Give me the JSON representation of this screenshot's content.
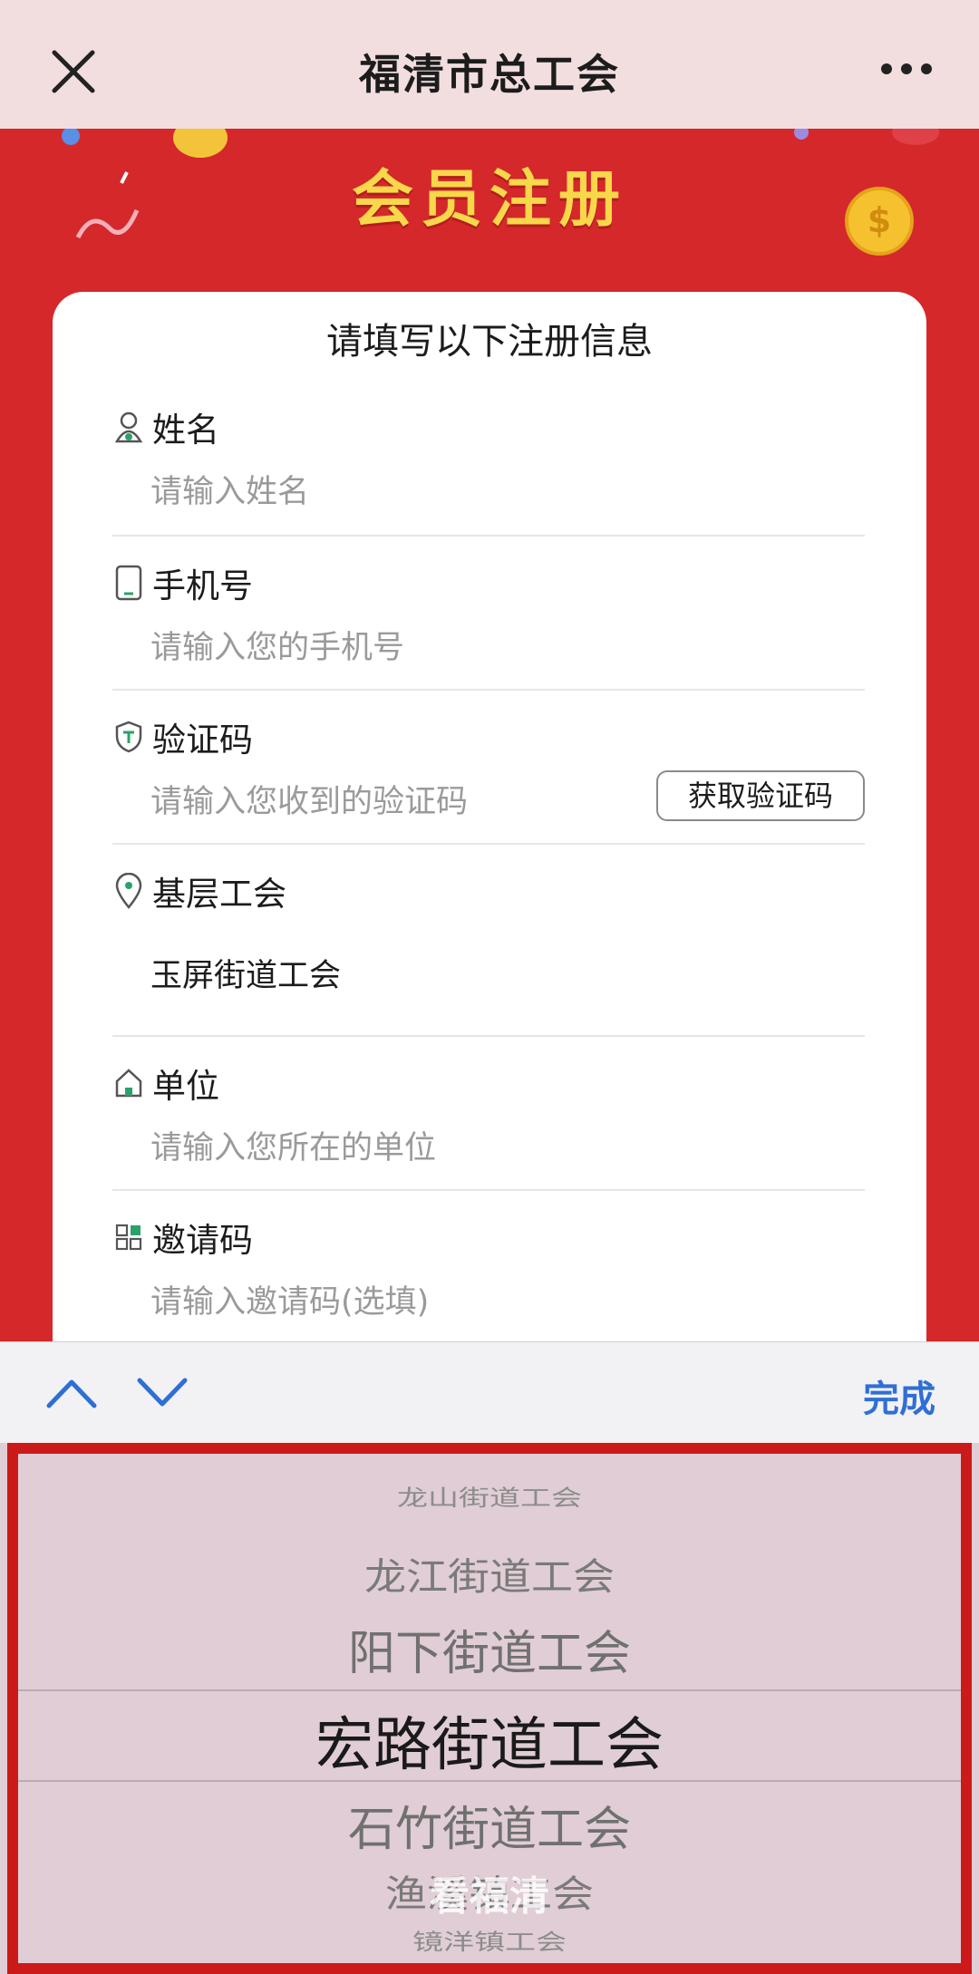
{
  "nav": {
    "title": "福清市总工会",
    "close_icon": "close-icon",
    "more_icon": "more-icon"
  },
  "hero": {
    "headline": "会员注册",
    "accent_color": "#f8d84a",
    "background_color": "#d5282b"
  },
  "form": {
    "title": "请填写以下注册信息",
    "fields": [
      {
        "label": "姓名",
        "icon": "person-icon",
        "placeholder": "请输入姓名"
      },
      {
        "label": "手机号",
        "icon": "phone-icon",
        "placeholder": "请输入您的手机号"
      },
      {
        "label": "验证码",
        "icon": "shield-icon",
        "placeholder": "请输入您收到的验证码",
        "button": "获取验证码"
      },
      {
        "label": "基层工会",
        "icon": "location-pin-icon",
        "value": "玉屏街道工会"
      },
      {
        "label": "单位",
        "icon": "home-icon",
        "placeholder": "请输入您所在的单位"
      },
      {
        "label": "邀请码",
        "icon": "grid-icon",
        "placeholder": "请输入邀请码(选填)"
      }
    ]
  },
  "keyboard_bar": {
    "up_icon": "chevron-up-icon",
    "down_icon": "chevron-down-icon",
    "done_label": "完成",
    "done_color": "#2f6fd4"
  },
  "picker": {
    "options": [
      "龙山街道工会",
      "龙江街道工会",
      "阳下街道工会",
      "宏路街道工会",
      "石竹街道工会",
      "渔溪镇工会",
      "镜洋镇工会"
    ],
    "selected": "宏路街道工会",
    "highlight_color": "#cc1a1a"
  },
  "watermark": {
    "text": "看福清"
  }
}
